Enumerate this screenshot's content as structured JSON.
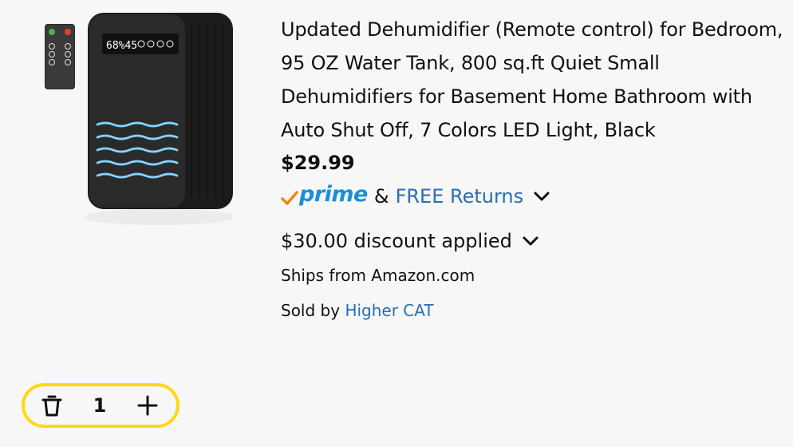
{
  "product": {
    "title": "Updated Dehumidifier (Remote control) for Bedroom, 95 OZ Water Tank, 800 sq.ft Quiet Small Dehumidifiers for Basement Home Bathroom with Auto Shut Off, 7 Colors LED Light, Black",
    "price": "$29.99",
    "prime_label": "prime",
    "ampersand": "&",
    "free_returns": "FREE Returns",
    "discount": "$30.00 discount applied",
    "ships_from": "Ships from Amazon.com",
    "sold_by_prefix": "Sold by",
    "seller": "Higher CAT",
    "display_readout": "68%45"
  },
  "quantity": {
    "value": "1"
  },
  "icons": {
    "delete": "trash-icon",
    "increase": "plus-icon",
    "expand": "chevron-down-icon",
    "prime_check": "prime-check-icon"
  },
  "colors": {
    "prime_blue": "#1a8fd9",
    "prime_check_orange": "#f08804",
    "link_blue": "#2a6eb5",
    "stepper_border": "#ffd814",
    "background": "#f7f7f7"
  }
}
